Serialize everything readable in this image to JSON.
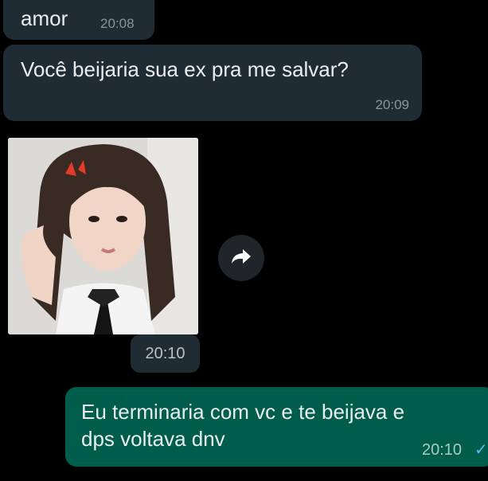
{
  "messages": [
    {
      "direction": "incoming",
      "text": "amor",
      "time": "20:08"
    },
    {
      "direction": "incoming",
      "text": "Você beijaria sua ex pra me salvar?",
      "time": "20:09"
    },
    {
      "direction": "incoming",
      "type": "image",
      "time": "20:10"
    },
    {
      "direction": "outgoing",
      "text": "Eu terminaria com vc e te beijava e\ndps voltava dnv",
      "time": "20:10",
      "status": "✓"
    }
  ],
  "icons": {
    "forward": "forward-arrow-icon",
    "read_status": "single-check-icon"
  },
  "colors": {
    "background": "#000000",
    "incoming_bubble": "#202c33",
    "outgoing_bubble": "#005c4b",
    "timestamp": "#8696a0",
    "tick": "#53bdeb"
  }
}
